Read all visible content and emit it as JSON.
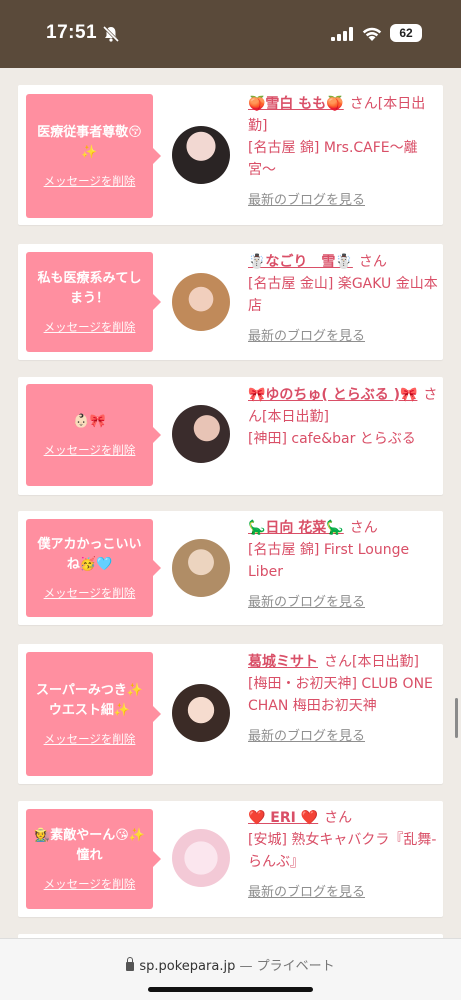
{
  "status": {
    "time": "17:51",
    "battery": "62"
  },
  "browser": {
    "domain": "sp.pokepara.jp",
    "separator": " — ",
    "private_label": "プライベート"
  },
  "delete_label": "メッセージを削除",
  "blog_label": "最新のブログを見る",
  "san_label": "さん",
  "cards": [
    {
      "message": "医療従事者尊敬😚✨",
      "name": "🍑雪白 もも🍑",
      "name_suffix": "[本日出勤]",
      "shop": "[名古屋 錦] Mrs.CAFE〜離宮〜"
    },
    {
      "message": "私も医療系みてしまう！",
      "name": "☃️なごり　雪☃️",
      "name_suffix": "",
      "shop": "[名古屋 金山] 楽GAKU 金山本店"
    },
    {
      "message": "👶🏻🎀",
      "name": "🎀ゆのちゅ( とらぶる )🎀",
      "name_suffix": "[本日出勤]",
      "shop": "[神田] cafe&bar とらぶる"
    },
    {
      "message": "僕アカかっこいいね🥳🩵",
      "name": "🦕日向 花菜🦕",
      "name_suffix": "",
      "shop": "[名古屋 錦] First Lounge Liber"
    },
    {
      "message": "スーパーみつき✨ウエスト細✨",
      "name": "葛城ミサト",
      "name_suffix": "[本日出勤]",
      "shop": "[梅田・お初天神] CLUB ONE CHAN 梅田お初天神"
    },
    {
      "message": "🧑‍🌾素敵やーん😘✨憧れ",
      "name": "❤️ ERI ❤️",
      "name_suffix": "",
      "shop": "[安城] 熟女キャバクラ『乱舞-らんぶ』"
    }
  ]
}
